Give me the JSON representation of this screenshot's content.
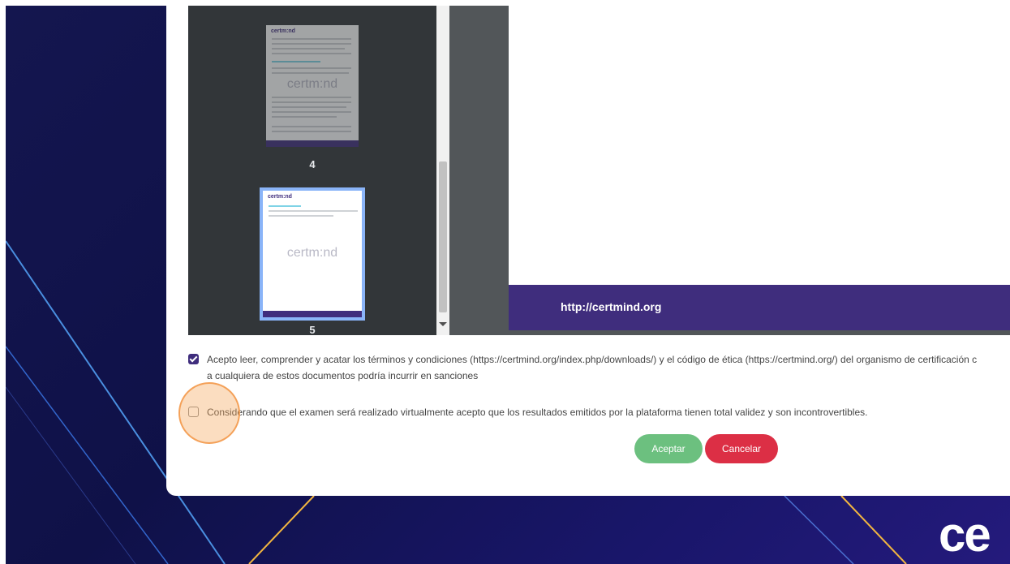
{
  "viewer": {
    "thumbnails": [
      {
        "page_number": "4",
        "header": "certm:nd",
        "watermark": "certm:nd"
      },
      {
        "page_number": "5",
        "header": "certm:nd",
        "watermark": "certm:nd"
      }
    ],
    "page_footer_url": "http://certmind.org"
  },
  "consents": [
    {
      "checked": true,
      "line1": "Acepto leer, comprender y acatar los términos y condiciones (https://certmind.org/index.php/downloads/) y el código de ética (https://certmind.org/) del organismo de certificación c",
      "line2": "a cualquiera de estos documentos podría incurrir en sanciones"
    },
    {
      "checked": false,
      "line1": "Considerando que el examen será realizado virtualmente acepto que los resultados emitidos por la plataforma tienen total validez y son incontrovertibles."
    }
  ],
  "buttons": {
    "accept_label": "Aceptar",
    "cancel_label": "Cancelar"
  },
  "brand_partial": "ce",
  "colors": {
    "brand_purple": "#3f2d7d",
    "accept_green": "#6cc07f",
    "cancel_red": "#dc2f45",
    "focus_orange": "#f4a65a"
  }
}
